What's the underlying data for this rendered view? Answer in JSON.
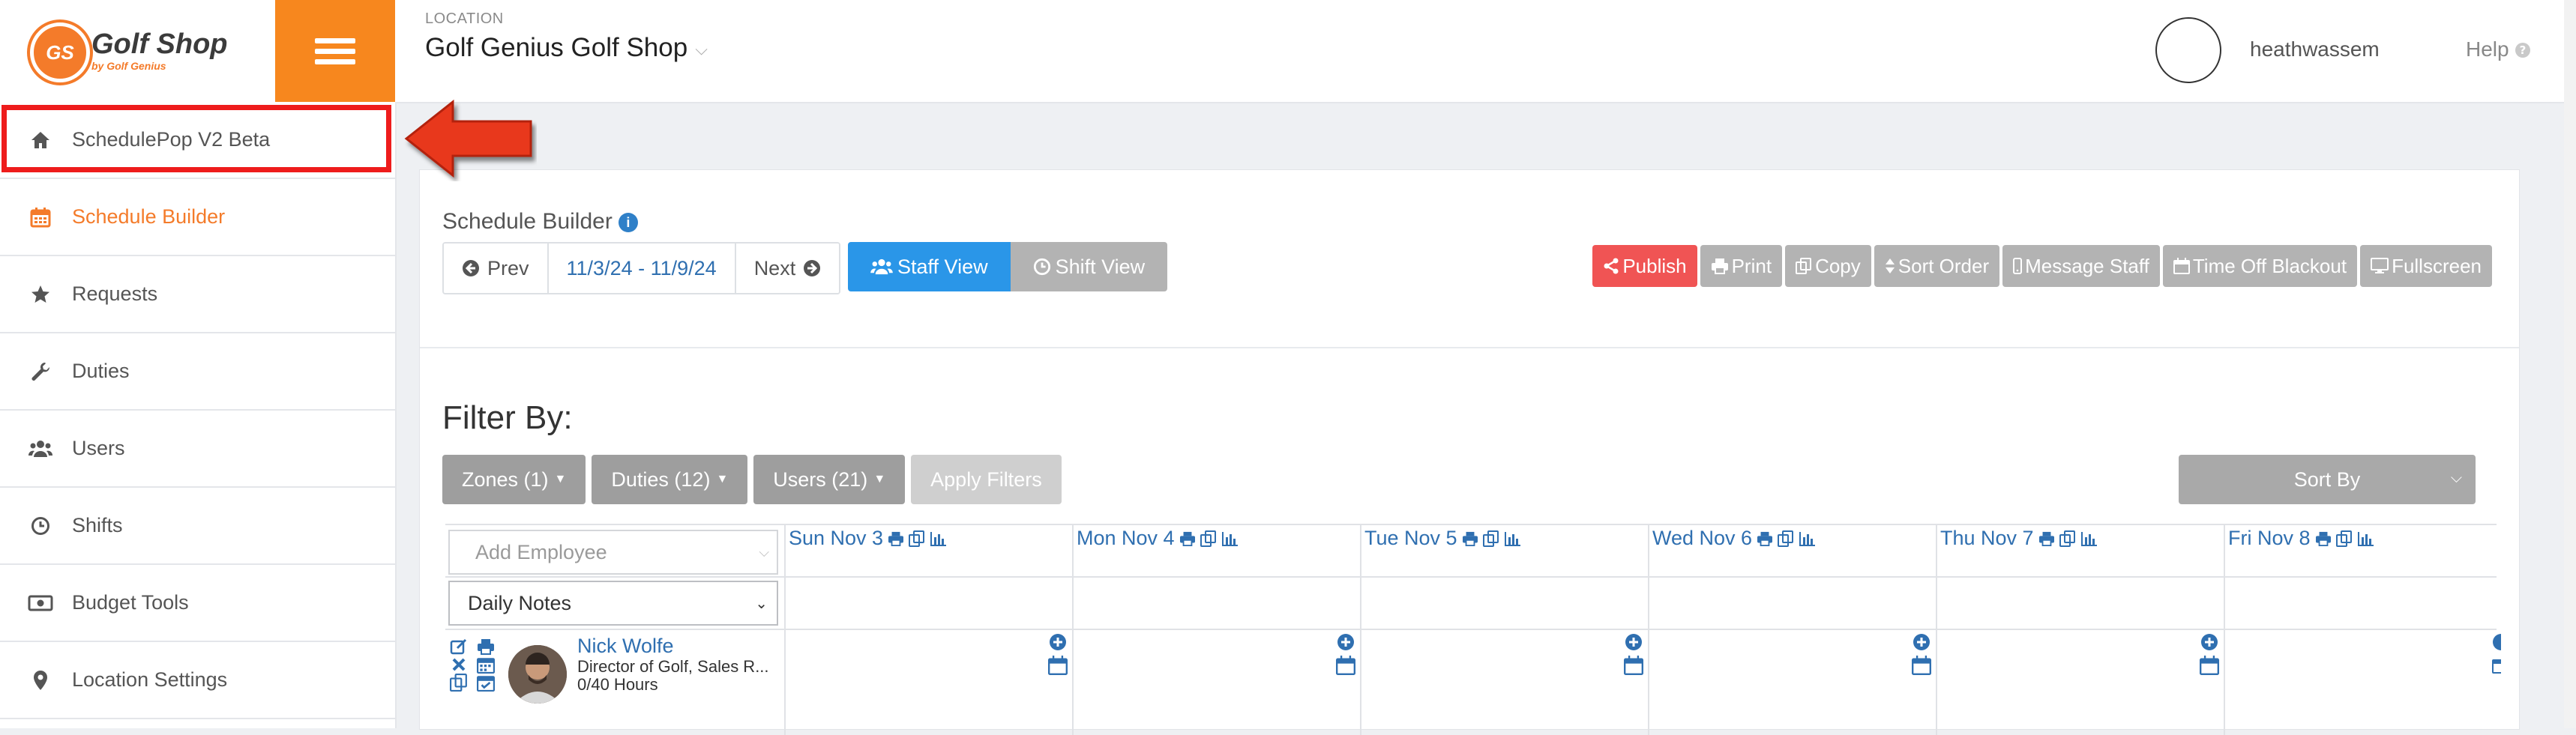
{
  "app": {
    "logo_badge": "GS",
    "logo_title": "Golf Shop",
    "logo_subtitle": "by Golf Genius"
  },
  "sidebar": {
    "items": [
      {
        "label": "SchedulePop V2 Beta",
        "icon": "home-icon"
      },
      {
        "label": "Schedule Builder",
        "icon": "calendar-icon",
        "active": true
      },
      {
        "label": "Requests",
        "icon": "star-icon"
      },
      {
        "label": "Duties",
        "icon": "wrench-icon"
      },
      {
        "label": "Users",
        "icon": "users-icon"
      },
      {
        "label": "Shifts",
        "icon": "clock-icon"
      },
      {
        "label": "Budget Tools",
        "icon": "money-icon"
      },
      {
        "label": "Location Settings",
        "icon": "map-marker-icon"
      }
    ]
  },
  "header": {
    "location_label": "LOCATION",
    "location_name": "Golf Genius Golf Shop",
    "username": "heathwassem",
    "help_label": "Help"
  },
  "schedule": {
    "title": "Schedule Builder",
    "prev_label": "Prev",
    "date_range": "11/3/24 - 11/9/24",
    "next_label": "Next",
    "staff_view_label": "Staff View",
    "shift_view_label": "Shift View",
    "actions": {
      "publish": "Publish",
      "print": "Print",
      "copy": "Copy",
      "sort_order": "Sort Order",
      "message_staff": "Message Staff",
      "time_off_blackout": "Time Off Blackout",
      "fullscreen": "Fullscreen"
    }
  },
  "filters": {
    "title": "Filter By:",
    "zones": "Zones (1)",
    "duties": "Duties (12)",
    "users": "Users (21)",
    "apply": "Apply Filters",
    "sort_by": "Sort By"
  },
  "grid": {
    "add_employee_placeholder": "Add Employee",
    "daily_notes": "Daily Notes",
    "days": [
      {
        "label": "Sun Nov 3"
      },
      {
        "label": "Mon Nov 4"
      },
      {
        "label": "Tue Nov 5"
      },
      {
        "label": "Wed Nov 6"
      },
      {
        "label": "Thu Nov 7"
      },
      {
        "label": "Fri Nov 8"
      }
    ],
    "employee": {
      "name": "Nick Wolfe",
      "title": "Director of Golf, Sales R...",
      "hours": "0/40 Hours"
    }
  },
  "colors": {
    "accent_orange": "#f7871e",
    "primary_blue": "#2a96e8",
    "link_blue": "#2f6fb0",
    "publish_red": "#f05454",
    "highlight_red": "#ee1c1c"
  }
}
